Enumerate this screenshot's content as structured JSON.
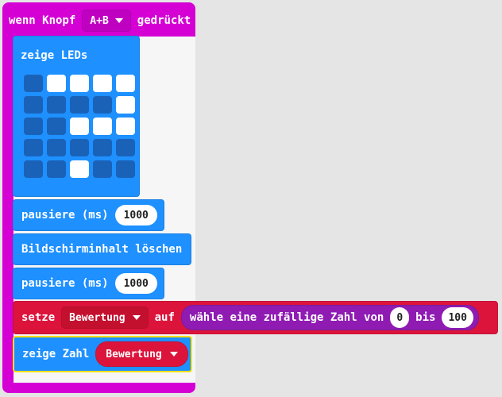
{
  "event_block": {
    "prefix": "wenn Knopf",
    "button": "A+B",
    "suffix": "gedrückt"
  },
  "show_leds": {
    "title": "zeige LEDs",
    "matrix": [
      [
        0,
        1,
        1,
        1,
        1
      ],
      [
        0,
        0,
        0,
        0,
        1
      ],
      [
        0,
        0,
        1,
        1,
        1
      ],
      [
        0,
        0,
        0,
        0,
        0
      ],
      [
        0,
        0,
        1,
        0,
        0
      ]
    ]
  },
  "pause_1": {
    "label": "pausiere (ms)",
    "value": "1000"
  },
  "clear_screen": {
    "label": "Bildschirminhalt löschen"
  },
  "pause_2": {
    "label": "pausiere (ms)",
    "value": "1000"
  },
  "set_var": {
    "label": "setze",
    "variable": "Bewertung",
    "to": "auf",
    "random_label": "wähle eine zufällige Zahl von",
    "from_value": "0",
    "bis": "bis",
    "to_value": "100"
  },
  "show_number": {
    "label": "zeige Zahl",
    "variable": "Bewertung"
  },
  "colors": {
    "event": "#d400d4",
    "basic": "#1e90ff",
    "variables": "#dc143c",
    "math": "#8f1bb3",
    "selected_outline": "#ffe000"
  }
}
